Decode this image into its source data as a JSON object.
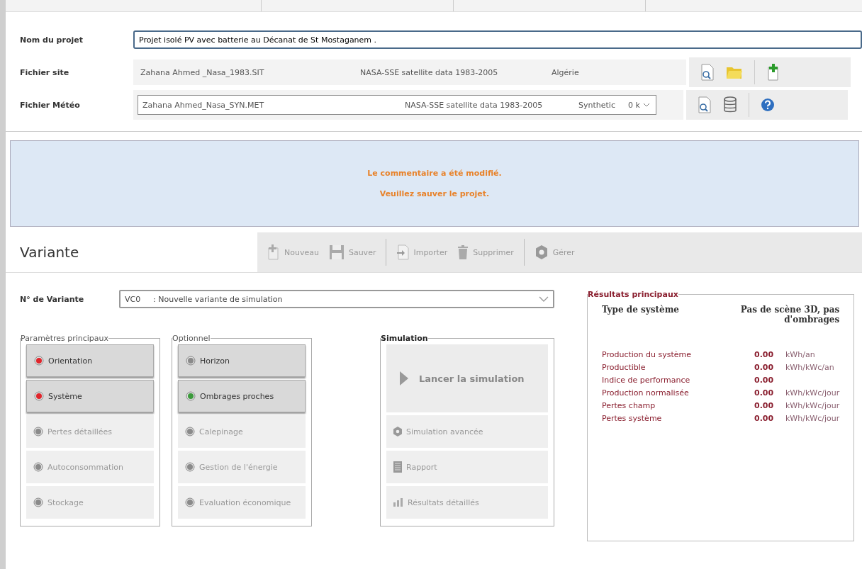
{
  "project": {
    "label": "Nom du projet",
    "value": "Projet isolé PV avec batterie au Décanat de St Mostaganem ."
  },
  "site_file": {
    "label": "Fichier site",
    "name": "Zahana Ahmed _Nasa_1983.SIT",
    "source": "NASA-SSE satellite data 1983-2005",
    "country": "Algérie"
  },
  "meteo_file": {
    "label": "Fichier Météo",
    "name": "Zahana Ahmed_Nasa_SYN.MET",
    "source": "NASA-SSE satellite data 1983-2005",
    "type": "Synthetic",
    "column_4": "0 k"
  },
  "notice": [
    "Le commentaire a été modifié.",
    "Veuillez sauver le projet."
  ],
  "variant_toolbar": {
    "title": "Variante",
    "buttons": [
      {
        "kind": "new",
        "label": "Nouveau"
      },
      {
        "kind": "save",
        "label": "Sauver"
      },
      {
        "kind": "import",
        "label": "Importer"
      },
      {
        "kind": "delete",
        "label": "Supprimer"
      },
      {
        "kind": "manage",
        "label": "Gérer"
      }
    ]
  },
  "variant": {
    "label": "N° de Variante",
    "code": "VC0",
    "name": ": Nouvelle variante de simulation"
  },
  "groups": [
    {
      "title": "Paramètres principaux",
      "items": [
        {
          "label": "Orientation",
          "enabled": true,
          "color": "#e0262c"
        },
        {
          "label": "Système",
          "enabled": true,
          "color": "#e0262c"
        },
        {
          "label": "Pertes détaillées",
          "enabled": false,
          "color": "#8a8a8a"
        },
        {
          "label": "Autoconsommation",
          "enabled": false,
          "color": "#8a8a8a"
        },
        {
          "label": "Stockage",
          "enabled": false,
          "color": "#8a8a8a"
        }
      ]
    },
    {
      "title": "Optionnel",
      "items": [
        {
          "label": "Horizon",
          "enabled": true,
          "color": "#8a8a8a"
        },
        {
          "label": "Ombrages proches",
          "enabled": true,
          "color": "#3c9a3c"
        },
        {
          "label": "Calepinage",
          "enabled": false,
          "color": "#8a8a8a"
        },
        {
          "label": "Gestion de l'énergie",
          "enabled": false,
          "color": "#8a8a8a"
        },
        {
          "label": "Evaluation économique",
          "enabled": false,
          "color": "#8a8a8a"
        }
      ]
    }
  ],
  "simulation": {
    "title": "Simulation",
    "run": "Lancer la simulation",
    "items": [
      {
        "kind": "advanced",
        "label": "Simulation avancée"
      },
      {
        "kind": "report",
        "label": "Rapport"
      },
      {
        "kind": "results",
        "label": "Résultats détaillés"
      }
    ]
  },
  "results": {
    "title": "Résultats principaux",
    "system_type_label": "Type de système",
    "system_type": "Pas de scène 3D, pas d'ombrages",
    "rows": [
      {
        "label": "Production du système",
        "value": "0.00",
        "unit": "kWh/an"
      },
      {
        "label": "Productible",
        "value": "0.00",
        "unit": "kWh/kWc/an"
      },
      {
        "label": "Indice de performance",
        "value": "0.00"
      },
      {
        "label": "Production normalisée",
        "value": "0.00",
        "unit": "kWh/kWc/jour"
      },
      {
        "label": "Pertes champ",
        "value": "0.00",
        "unit": "kWh/kWc/jour"
      },
      {
        "label": "Pertes système",
        "value": "0.00",
        "unit": "kWh/kWc/jour"
      }
    ]
  }
}
